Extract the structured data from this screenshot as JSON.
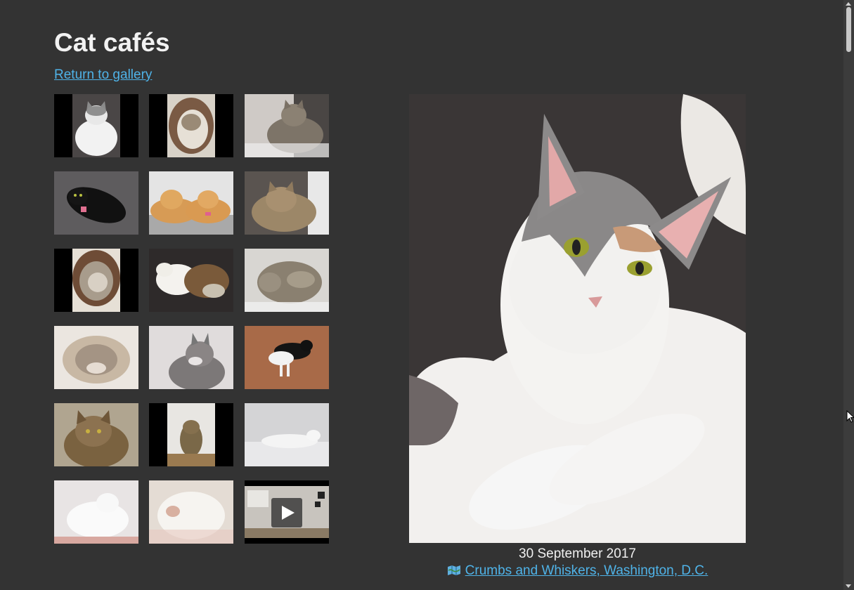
{
  "page": {
    "title": "Cat cafés",
    "return_link": "Return to gallery"
  },
  "thumbnails": [
    {
      "name": "thumb-1",
      "type": "photo"
    },
    {
      "name": "thumb-2",
      "type": "photo"
    },
    {
      "name": "thumb-3",
      "type": "photo"
    },
    {
      "name": "thumb-4",
      "type": "photo"
    },
    {
      "name": "thumb-5",
      "type": "photo"
    },
    {
      "name": "thumb-6",
      "type": "photo"
    },
    {
      "name": "thumb-7",
      "type": "photo"
    },
    {
      "name": "thumb-8",
      "type": "photo"
    },
    {
      "name": "thumb-9",
      "type": "photo"
    },
    {
      "name": "thumb-10",
      "type": "photo"
    },
    {
      "name": "thumb-11",
      "type": "photo"
    },
    {
      "name": "thumb-12",
      "type": "photo"
    },
    {
      "name": "thumb-13",
      "type": "photo"
    },
    {
      "name": "thumb-14",
      "type": "photo"
    },
    {
      "name": "thumb-15",
      "type": "photo"
    },
    {
      "name": "thumb-16",
      "type": "photo"
    },
    {
      "name": "thumb-17",
      "type": "photo"
    },
    {
      "name": "thumb-18",
      "type": "video"
    }
  ],
  "main_photo": {
    "date": "30 September 2017",
    "location": "Crumbs and Whiskers, Washington, D.C.",
    "location_icon": "map-icon"
  },
  "colors": {
    "background": "#333333",
    "link": "#4fb3e8",
    "text": "#f0f0f0"
  }
}
